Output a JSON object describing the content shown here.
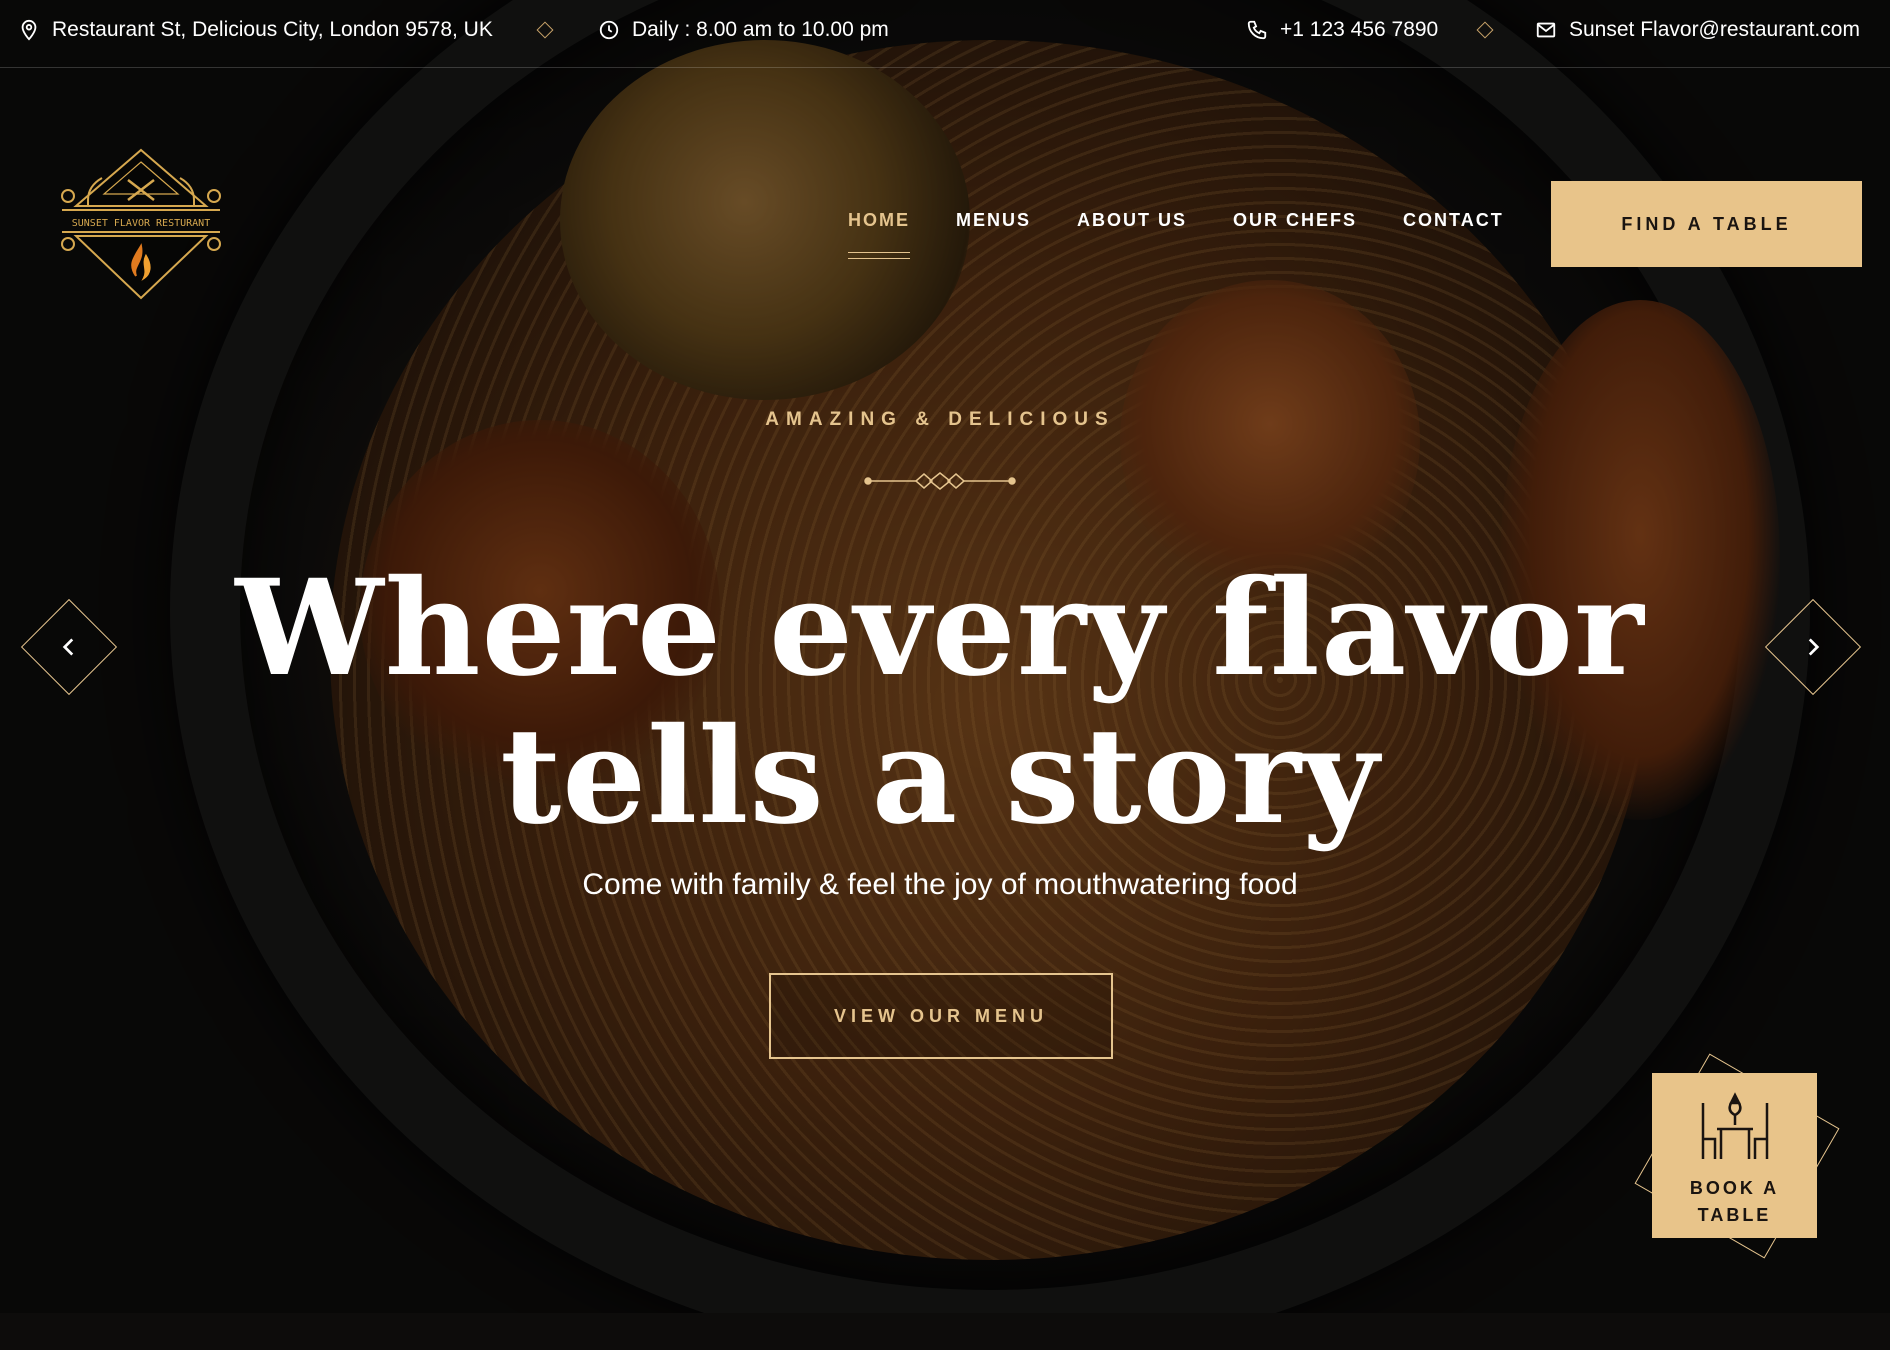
{
  "topbar": {
    "address": "Restaurant St, Delicious City, London 9578, UK",
    "hours": "Daily : 8.00 am to 10.00 pm",
    "phone": "+1 123 456 7890",
    "email": "Sunset Flavor@restaurant.com",
    "icons": [
      "location-pin-icon",
      "clock-icon",
      "phone-icon",
      "mail-icon"
    ]
  },
  "logo": {
    "text": "SUNSET FLAVOR RESTURANT"
  },
  "nav": {
    "items": [
      {
        "label": "HOME",
        "active": true
      },
      {
        "label": "MENUS",
        "active": false
      },
      {
        "label": "ABOUT US",
        "active": false
      },
      {
        "label": "OUR CHEFS",
        "active": false
      },
      {
        "label": "CONTACT",
        "active": false
      }
    ],
    "cta_label": "FIND A TABLE"
  },
  "hero": {
    "tagline": "AMAZING & DELICIOUS",
    "headline_line1": "Where every flavor",
    "headline_line2": "tells a story",
    "subline": "Come with family & feel the joy of mouthwatering food",
    "button_label": "VIEW OUR MENU",
    "prev_icon": "chevron-left-icon",
    "next_icon": "chevron-right-icon"
  },
  "book_table": {
    "label": "BOOK A\nTABLE",
    "icon": "dining-table-icon"
  },
  "colors": {
    "accent": "#e5c48e",
    "button_bg": "#e8c48a",
    "dark": "#0c0b0a"
  }
}
